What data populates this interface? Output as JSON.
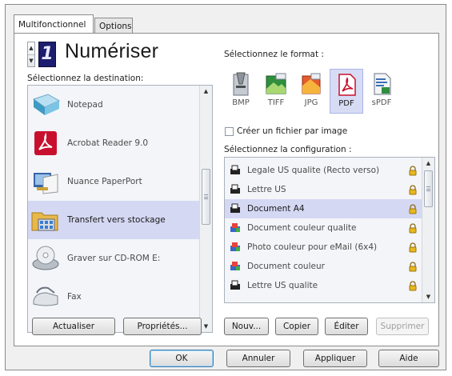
{
  "tabs": [
    {
      "label": "Multifonctionnel",
      "active": true
    },
    {
      "label": "Options",
      "active": false
    }
  ],
  "scan": {
    "counter_value": "1",
    "title": "Numériser",
    "spin_up": "▲",
    "spin_down": "▼"
  },
  "destination": {
    "label": "Sélectionnez la destination:",
    "items": [
      {
        "label": "Notepad",
        "icon": "notepad-icon"
      },
      {
        "label": "Acrobat Reader 9.0",
        "icon": "acrobat-icon"
      },
      {
        "label": "Nuance PaperPort",
        "icon": "paperport-icon"
      },
      {
        "label": "Transfert vers stockage",
        "icon": "storage-transfer-icon",
        "selected": true
      },
      {
        "label": "Graver sur CD-ROM  E:",
        "icon": "cd-rom-icon"
      },
      {
        "label": "Fax",
        "icon": "fax-icon"
      }
    ]
  },
  "format": {
    "label": "Sélectionnez le format :",
    "items": [
      {
        "label": "BMP",
        "icon": "bmp-icon"
      },
      {
        "label": "TIFF",
        "icon": "tiff-icon"
      },
      {
        "label": "JPG",
        "icon": "jpg-icon"
      },
      {
        "label": "PDF",
        "icon": "pdf-icon",
        "selected": true
      },
      {
        "label": "sPDF",
        "icon": "spdf-icon"
      }
    ],
    "per_image_checkbox_label": "Créer un fichier par image",
    "per_image_checked": false
  },
  "configuration": {
    "label": "Sélectionnez la configuration :",
    "items": [
      {
        "label": "Legale US qualite (Recto verso)",
        "icon": "bw-scan-icon"
      },
      {
        "label": "Lettre US",
        "icon": "bw-scan-icon"
      },
      {
        "label": "Document A4",
        "icon": "bw-scan-icon",
        "selected": true
      },
      {
        "label": "Document couleur qualite",
        "icon": "color-scan-icon"
      },
      {
        "label": "Photo couleur pour eMail (6x4)",
        "icon": "color-scan-icon"
      },
      {
        "label": "Document couleur",
        "icon": "color-scan-icon"
      },
      {
        "label": "Lettre US qualite",
        "icon": "bw-scan-icon"
      }
    ]
  },
  "buttons": {
    "refresh": "Actualiser",
    "properties": "Propriétés...",
    "new": "Nouv...",
    "copy": "Copier",
    "edit": "Éditer",
    "delete": "Supprimer",
    "ok": "OK",
    "cancel": "Annuler",
    "apply": "Appliquer",
    "help": "Aide"
  },
  "colors": {
    "selection": "#d5d8f3",
    "lcd_background": "#1c1d6e",
    "pdf_red": "#c8102e"
  }
}
